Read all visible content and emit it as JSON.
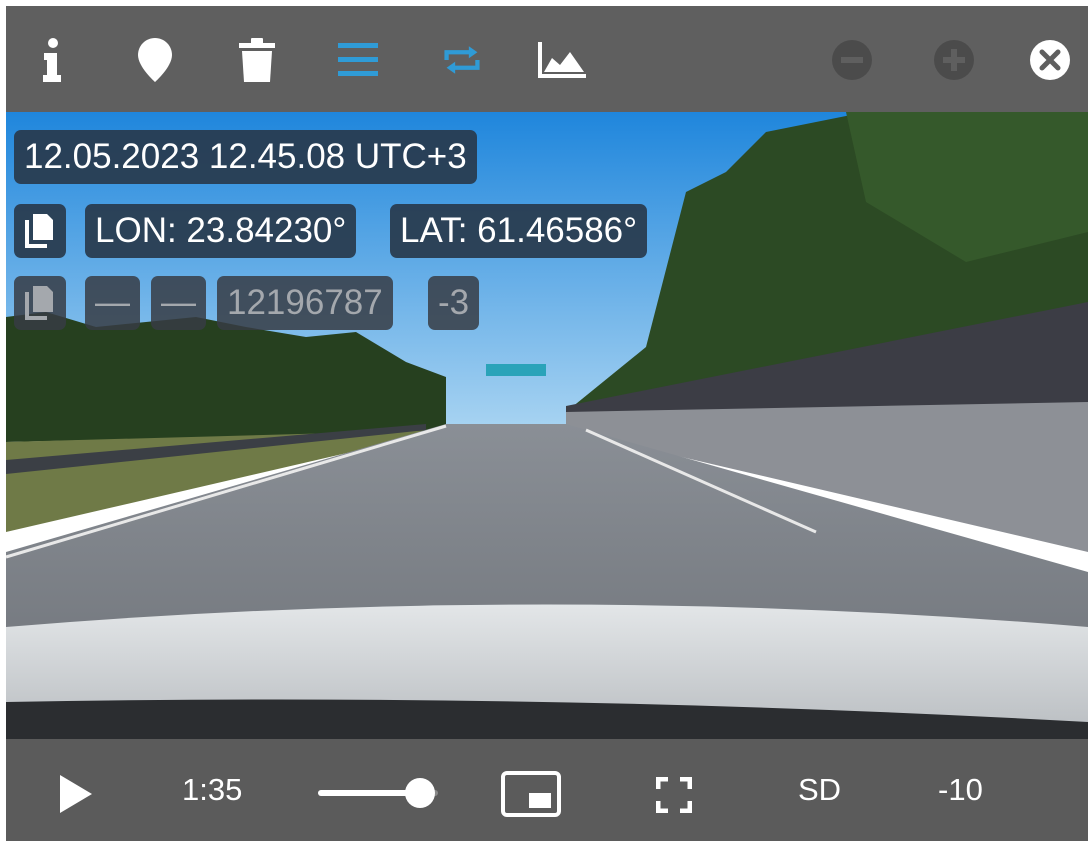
{
  "toolbar": {
    "icons": [
      "info-icon",
      "map-marker-icon",
      "trash-icon",
      "list-icon",
      "repeat-icon",
      "area-chart-icon",
      "zoom-out-icon",
      "zoom-in-icon",
      "close-icon"
    ],
    "accent": "#2f9bd6"
  },
  "overlay": {
    "timestamp": "12.05.2023 12.45.08 UTC+3",
    "lon": "LON: 23.84230°",
    "lat": "LAT: 61.46586°",
    "dash_1": "—",
    "dash_2": "—",
    "id": "12196787",
    "offset": "-3"
  },
  "player": {
    "time": "1:35",
    "quality": "SD",
    "skip": "-10",
    "volume_level": 0.85
  }
}
